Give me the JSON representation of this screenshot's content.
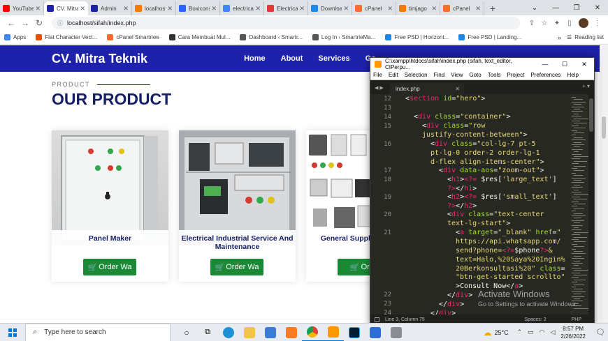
{
  "browser": {
    "tabs": [
      {
        "title": "YouTube",
        "color": "#ff0000",
        "active": false
      },
      {
        "title": "CV. Mitra Teknik",
        "color": "#1e22aa",
        "active": true
      },
      {
        "title": "Admin",
        "color": "#1e22aa",
        "active": false
      },
      {
        "title": "localhost",
        "color": "#f57c00",
        "active": false
      },
      {
        "title": "Boxicons",
        "color": "#2962ff",
        "active": false
      },
      {
        "title": "electrical",
        "color": "#4285f4",
        "active": false
      },
      {
        "title": "Electrical",
        "color": "#e53935",
        "active": false
      },
      {
        "title": "Download",
        "color": "#1e88e5",
        "active": false
      },
      {
        "title": "cPanel",
        "color": "#ff6c2c",
        "active": false
      },
      {
        "title": "timjago",
        "color": "#f57c00",
        "active": false
      },
      {
        "title": "cPanel",
        "color": "#ff6c2c",
        "active": false
      }
    ],
    "new_tab": "+",
    "url": "localhost/sifah/index.php",
    "bookmarks": [
      {
        "label": "Apps",
        "color": "#4285f4"
      },
      {
        "label": "Flat Character Vect...",
        "color": "#e65100"
      },
      {
        "label": "cPanel Smartriee",
        "color": "#ff6c2c"
      },
      {
        "label": "Cara Membuat Mul...",
        "color": "#333333"
      },
      {
        "label": "Dashboard ‹ Smartr...",
        "color": "#555555"
      },
      {
        "label": "Log In ‹ SmartrieMa...",
        "color": "#555555"
      },
      {
        "label": "Free PSD | Horizont...",
        "color": "#1e88e5"
      },
      {
        "label": "Free PSD | Landing...",
        "color": "#1e88e5"
      }
    ],
    "bookmarks_more": "»",
    "reading_list": "Reading list"
  },
  "site": {
    "brand": "CV. Mitra Teknik",
    "menu": [
      "Home",
      "About",
      "Services",
      "Go"
    ],
    "section_label": "PRODUCT",
    "section_title": "OUR PRODUCT",
    "products": [
      {
        "name": "Panel Maker",
        "button": "Order Wa"
      },
      {
        "name": "Electrical Industrial Service And Maintenance",
        "button": "Order Wa"
      },
      {
        "name": "General Supplier Equipm",
        "button": "Orde"
      }
    ]
  },
  "editor": {
    "title": "C:\\xampp\\htdocs\\sifah\\index.php (sifah, text_editor, CIPerpu...",
    "menu": [
      "File",
      "Edit",
      "Selection",
      "Find",
      "View",
      "Goto",
      "Tools",
      "Project",
      "Preferences",
      "Help"
    ],
    "tab": "index.php",
    "line_numbers": [
      "12",
      "13",
      "14",
      "15",
      "16",
      "17",
      "18",
      "19",
      "20",
      "21",
      "22",
      "23",
      "24"
    ],
    "status_position": "Line 3, Column 75",
    "status_spaces": "Spaces: 2",
    "status_lang": "PHP"
  },
  "watermark": {
    "line1": "Activate Windows",
    "line2": "Go to Settings to activate Windows."
  },
  "taskbar": {
    "search_placeholder": "Type here to search",
    "temperature": "25°C",
    "time": "8:57 PM",
    "date": "2/26/2022"
  }
}
